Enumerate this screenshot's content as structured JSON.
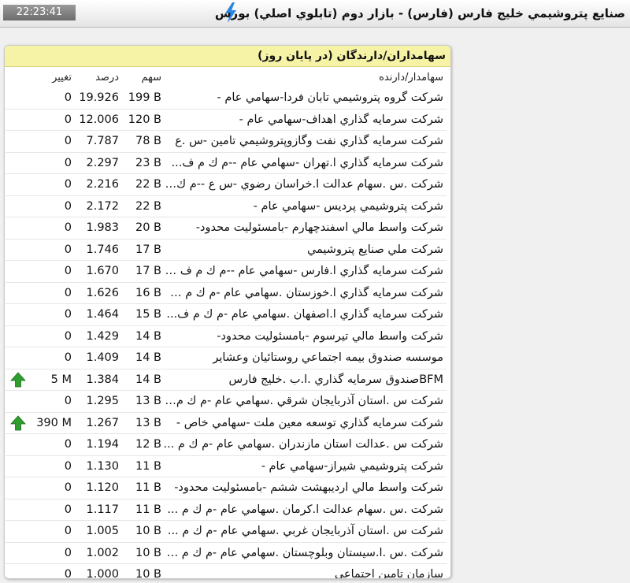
{
  "window": {
    "clock": "22:23:41",
    "title": "صنايع پتروشيمي خليج فارس (فارس) - بازار دوم (تابلوي اصلي) بورس"
  },
  "panel": {
    "title": "سهامداران/دارندگان (در پايان روز)",
    "columns": {
      "holder": "سهامدار/دارنده",
      "shares": "سهم",
      "percent": "درصد",
      "change": "تغيير"
    },
    "rows": [
      {
        "holder": "شركت گروه پتروشيمي تابان فردا-سهامي عام -",
        "shares": "199 B",
        "percent": "19.926",
        "change": "0",
        "arrow": ""
      },
      {
        "holder": "شركت سرمايه گذاري اهداف-سهامي عام -",
        "shares": "120 B",
        "percent": "12.006",
        "change": "0",
        "arrow": ""
      },
      {
        "holder": "شركت سرمايه گذاري نفت وگازوپتروشيمي تامين -س .ع",
        "shares": "78 B",
        "percent": "7.787",
        "change": "0",
        "arrow": ""
      },
      {
        "holder": "شركت سرمايه گذاري ا.تهران -سهامي عام --م ك م ف...",
        "shares": "23 B",
        "percent": "2.297",
        "change": "0",
        "arrow": ""
      },
      {
        "holder": "شركت .س .سهام عدالت ا.خراسان رضوي -س ع --م ك م...",
        "shares": "22 B",
        "percent": "2.216",
        "change": "0",
        "arrow": ""
      },
      {
        "holder": "شركت پتروشيمي پرديس -سهامي عام -",
        "shares": "22 B",
        "percent": "2.172",
        "change": "0",
        "arrow": ""
      },
      {
        "holder": "شركت واسط مالي اسفندچهارم -بامسئوليت محدود-",
        "shares": "20 B",
        "percent": "1.983",
        "change": "0",
        "arrow": ""
      },
      {
        "holder": "شركت ملي صنايع پتروشيمي",
        "shares": "17 B",
        "percent": "1.746",
        "change": "0",
        "arrow": ""
      },
      {
        "holder": "شركت سرمايه گذاري ا.فارس -سهامي عام --م ك م ف ع -",
        "shares": "17 B",
        "percent": "1.670",
        "change": "0",
        "arrow": ""
      },
      {
        "holder": "شركت سرمايه گذاري ا.خوزستان .سهامي عام -م ك م ف...",
        "shares": "16 B",
        "percent": "1.626",
        "change": "0",
        "arrow": ""
      },
      {
        "holder": "شركت سرمايه گذاري ا.اصفهان .سهامي عام -م ك م ف...",
        "shares": "15 B",
        "percent": "1.464",
        "change": "0",
        "arrow": ""
      },
      {
        "holder": "شركت واسط مالي تيرسوم -بامسئوليت محدود-",
        "shares": "14 B",
        "percent": "1.429",
        "change": "0",
        "arrow": ""
      },
      {
        "holder": "موسسه صندوق بيمه اجتماعي روستائيان وعشاير",
        "shares": "14 B",
        "percent": "1.409",
        "change": "0",
        "arrow": ""
      },
      {
        "holder": "BFMصندوق سرمايه گذاري .ا.ب .خليج فارس",
        "shares": "14 B",
        "percent": "1.384",
        "change": "5 M",
        "arrow": "up-arrow-icon"
      },
      {
        "holder": "شركت س .استان آذربايجان شرقي .سهامي عام -م ك م ...",
        "shares": "13 B",
        "percent": "1.295",
        "change": "0",
        "arrow": ""
      },
      {
        "holder": "شركت سرمايه گذاري توسعه معين ملت -سهامي خاص -",
        "shares": "13 B",
        "percent": "1.267",
        "change": "390 M",
        "arrow": "up-arrow-icon"
      },
      {
        "holder": "شركت س .عدالت استان مازندران .سهامي عام -م ك م ...",
        "shares": "12 B",
        "percent": "1.194",
        "change": "0",
        "arrow": ""
      },
      {
        "holder": "شركت پتروشيمي شيراز-سهامي عام -",
        "shares": "11 B",
        "percent": "1.130",
        "change": "0",
        "arrow": ""
      },
      {
        "holder": "شركت واسط مالي ارديبهشت ششم -بامسئوليت محدود-",
        "shares": "11 B",
        "percent": "1.120",
        "change": "0",
        "arrow": ""
      },
      {
        "holder": "شركت .س .سهام عدالت ا.كرمان .سهامي عام -م ك م ...",
        "shares": "11 B",
        "percent": "1.117",
        "change": "0",
        "arrow": ""
      },
      {
        "holder": "شركت س .استان آذربايجان غربي .سهامي عام -م ك م ...",
        "shares": "10 B",
        "percent": "1.005",
        "change": "0",
        "arrow": ""
      },
      {
        "holder": "شركت .س .ا.سيستان وبلوچستان .سهامي عام -م ك م ف...",
        "shares": "10 B",
        "percent": "1.002",
        "change": "0",
        "arrow": ""
      },
      {
        "holder": "سازمان تامين اجتماعي",
        "shares": "10 B",
        "percent": "1.000",
        "change": "0",
        "arrow": ""
      }
    ]
  },
  "colors": {
    "header_bg": "#f6f3a6",
    "arrow_green": "#2e9e2e"
  },
  "icons": {
    "bolt": "lightning-bolt-icon",
    "arrow": "up-arrow-icon"
  }
}
